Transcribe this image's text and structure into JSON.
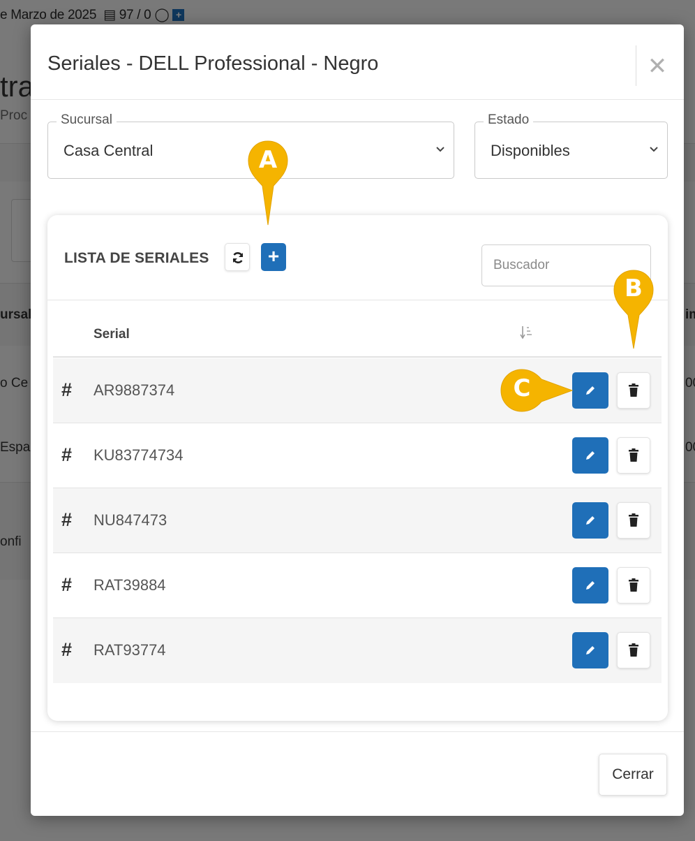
{
  "background": {
    "date_text": "e Marzo de 2025",
    "counter_text": "97 / 0",
    "title_fragment": "tra",
    "subtitle_fragment": "Proc",
    "column_fragment": "ursal",
    "column_fragment_right": "im",
    "row1_fragment": "o Ce",
    "row2_fragment": "Espa",
    "config_fragment": "onfi",
    "row_value_fragment": "00"
  },
  "modal": {
    "title": "Seriales - DELL Professional - Negro",
    "close_symbol": "✕",
    "sucursal": {
      "label": "Sucursal",
      "value": "Casa Central"
    },
    "estado": {
      "label": "Estado",
      "value": "Disponibles"
    },
    "list": {
      "title": "LISTA DE SERIALES",
      "add_symbol": "+",
      "search_placeholder": "Buscador",
      "column_serial": "Serial",
      "rows": [
        {
          "hash": "#",
          "serial": "AR9887374"
        },
        {
          "hash": "#",
          "serial": "KU83774734"
        },
        {
          "hash": "#",
          "serial": "NU847473"
        },
        {
          "hash": "#",
          "serial": "RAT39884"
        },
        {
          "hash": "#",
          "serial": "RAT93774"
        }
      ]
    },
    "footer_close_label": "Cerrar"
  },
  "annotations": {
    "a": "A",
    "b": "B",
    "c": "C"
  },
  "colors": {
    "primary": "#1f6fb8",
    "marker": "#f5b400"
  }
}
